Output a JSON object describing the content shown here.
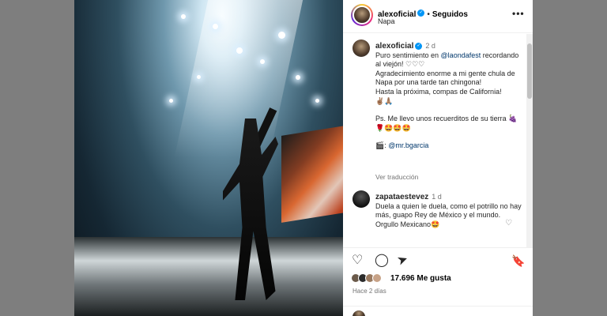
{
  "post": {
    "username": "alexoficial",
    "follow_status": "Seguidos",
    "location": "Napa"
  },
  "caption": {
    "username": "alexoficial",
    "age": "2 d",
    "line1_prefix": "Puro sentimiento en ",
    "mention": "@laondafest",
    "line1_suffix": " recordando al viejón! ♡♡♡",
    "line2": "Agradecimiento enorme a mi gente chula de Napa por una tarde tan chingona!",
    "line3": "Hasta la próxima, compas de California!",
    "line3_emoji": "✌🏽🙏🏽",
    "line4": "Ps. Me llevo unos recuerditos de su tierra ",
    "line4_emoji": "🍇🌹🤩🤩🤩",
    "credit_icon": "🎬",
    "credit_sep": ": ",
    "credit_mention": "@mr.bgarcia",
    "translate": "Ver traducción"
  },
  "comment": {
    "username": "zapataestevez",
    "age": "1 d",
    "text": "Duela a quien le duela, como el potrillo no hay más, guapo Rey de México y el mundo. Orgullo Mexicano",
    "emoji": "🤩"
  },
  "actions": {
    "likes": "17.696 Me gusta",
    "time": "Hace 2 días"
  },
  "icons": {
    "more": "•••",
    "next": "›",
    "heart": "♡",
    "verified": "✓",
    "like": "♡",
    "comment": "◯",
    "share": "➤",
    "save": "🔖"
  }
}
